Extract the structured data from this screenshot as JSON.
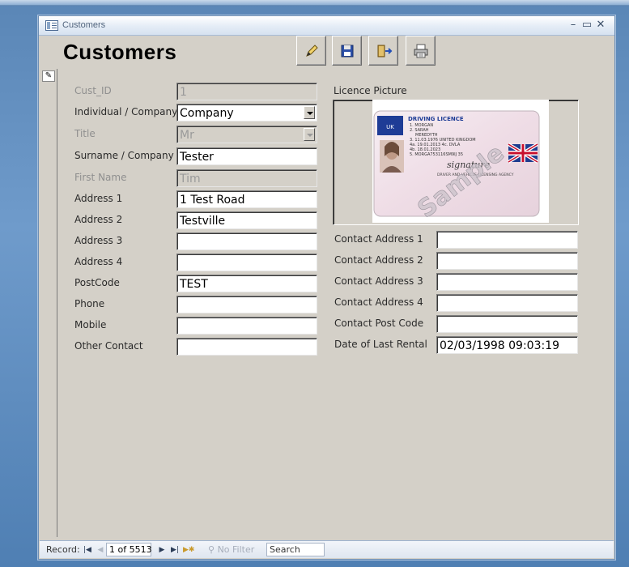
{
  "window": {
    "title": "Customers"
  },
  "form": {
    "heading": "Customers"
  },
  "toolbar": {
    "buttons": [
      {
        "name": "edit",
        "icon": "pencil-icon"
      },
      {
        "name": "save",
        "icon": "floppy-disk-icon"
      },
      {
        "name": "exit",
        "icon": "exit-door-icon"
      },
      {
        "name": "print",
        "icon": "printer-icon"
      }
    ]
  },
  "record_selector": {
    "icon": "pencil-edit-icon",
    "glyph": "✎"
  },
  "left_fields": [
    {
      "label": "Cust_ID",
      "value": "1",
      "disabled": true,
      "combo": false
    },
    {
      "label": "Individual / Company",
      "value": "Company",
      "disabled": false,
      "combo": true
    },
    {
      "label": "Title",
      "value": "Mr",
      "disabled": true,
      "combo": true
    },
    {
      "label": "Surname / Company",
      "value": "Tester",
      "disabled": false,
      "combo": false
    },
    {
      "label": "First Name",
      "value": "Tim",
      "disabled": true,
      "combo": false
    },
    {
      "label": "Address 1",
      "value": "1 Test Road",
      "disabled": false,
      "combo": false
    },
    {
      "label": "Address 2",
      "value": "Testville",
      "disabled": false,
      "combo": false
    },
    {
      "label": "Address 3",
      "value": "",
      "disabled": false,
      "combo": false
    },
    {
      "label": "Address 4",
      "value": "",
      "disabled": false,
      "combo": false
    },
    {
      "label": "PostCode",
      "value": "TEST",
      "disabled": false,
      "combo": false
    },
    {
      "label": "Phone",
      "value": "",
      "disabled": false,
      "combo": false
    },
    {
      "label": "Mobile",
      "value": "",
      "disabled": false,
      "combo": false
    },
    {
      "label": "Other Contact",
      "value": "",
      "disabled": false,
      "combo": false
    }
  ],
  "licence": {
    "label": "Licence Picture",
    "card": {
      "header": "DRIVING LICENCE",
      "lines": [
        "1. MORGAN",
        "2. SARAH",
        "MEREDYTH",
        "3. 11.03.1976 UNITED KINGDOM",
        "4a. 19.01.2013  4c. DVLA",
        "4b. 18.01.2023",
        "5.  MORGA753116SM9IJ 35"
      ],
      "watermark": "Sample",
      "signature": "signature",
      "agency": "DRIVER AND VEHICLE LICENSING AGENCY",
      "eu_badge": "UK"
    }
  },
  "right_fields": [
    {
      "label": "Contact Address 1",
      "value": ""
    },
    {
      "label": "Contact Address 2",
      "value": ""
    },
    {
      "label": "Contact Address 3",
      "value": ""
    },
    {
      "label": "Contact Address 4",
      "value": ""
    },
    {
      "label": "Contact Post Code",
      "value": ""
    },
    {
      "label": "Date of Last Rental",
      "value": "02/03/1998 09:03:19"
    }
  ],
  "navigation": {
    "record_label": "Record:",
    "position": "1 of 5513",
    "filter_label": "No Filter",
    "search_placeholder": "Search",
    "buttons": [
      "first-record-icon",
      "previous-record-icon",
      "next-record-icon",
      "last-record-icon",
      "new-record-icon"
    ]
  }
}
